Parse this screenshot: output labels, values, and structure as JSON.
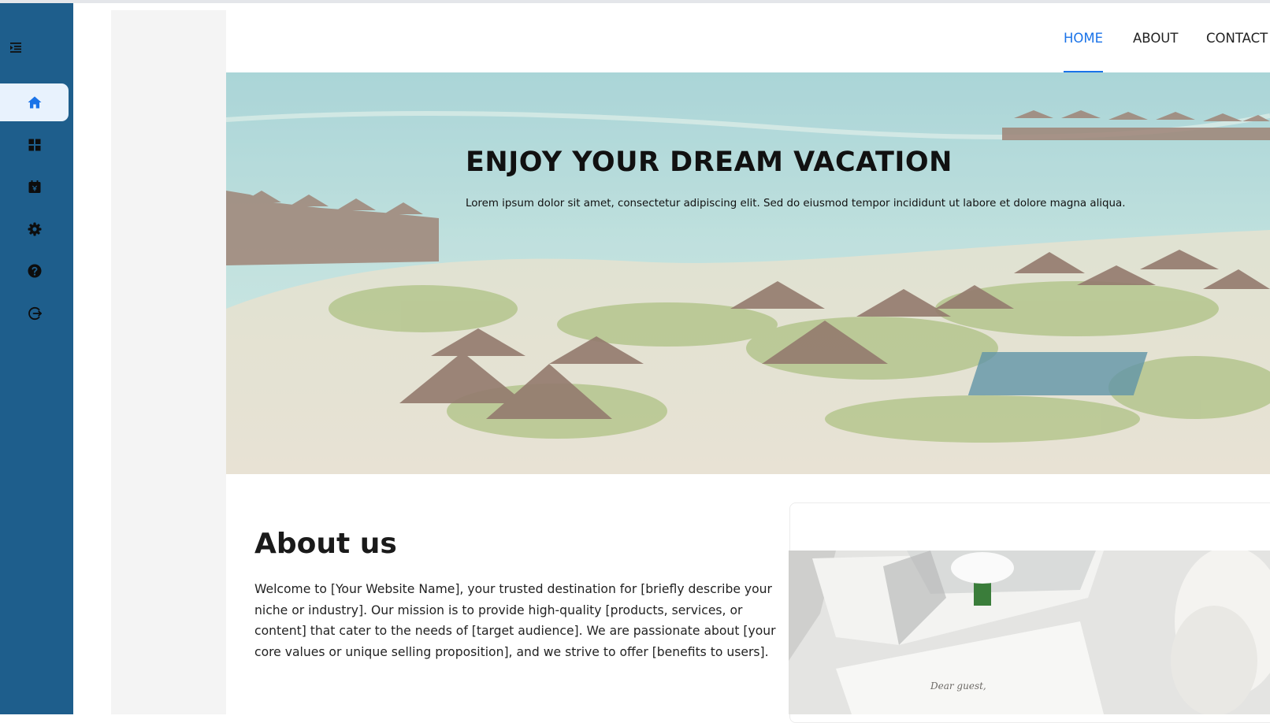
{
  "sidebar": {
    "toggle_icon": "menu-indent-icon",
    "items": [
      {
        "id": "home",
        "icon": "home-icon",
        "active": true
      },
      {
        "id": "dashboard",
        "icon": "grid-icon",
        "active": false
      },
      {
        "id": "bookings",
        "icon": "calendar-icon",
        "active": false
      },
      {
        "id": "settings",
        "icon": "gear-icon",
        "active": false
      },
      {
        "id": "help",
        "icon": "help-icon",
        "active": false
      },
      {
        "id": "logout",
        "icon": "logout-icon",
        "active": false
      }
    ]
  },
  "nav": {
    "links": [
      {
        "label": "HOME",
        "active": true
      },
      {
        "label": "ABOUT",
        "active": false
      },
      {
        "label": "CONTACT",
        "active": false
      }
    ]
  },
  "hero": {
    "title": "ENJOY YOUR DREAM VACATION",
    "subtitle": "Lorem ipsum dolor sit amet, consectetur adipiscing elit. Sed do eiusmod tempor incididunt ut labore et dolore magna aliqua."
  },
  "about": {
    "heading": "About us",
    "body": "Welcome to [Your Website Name], your trusted destination for [briefly describe your niche or industry]. Our mission is to provide high-quality [products, services, or content] that cater to the needs of [target audience]. We are passionate about [your core values or unique selling proposition], and we strive to offer [benefits to users].",
    "image_note": "Dear guest,"
  },
  "colors": {
    "sidebar": "#1e5e8c",
    "accent": "#1a73e8",
    "active_item": "#e8f2fd",
    "gutter": "#f4f4f4"
  }
}
